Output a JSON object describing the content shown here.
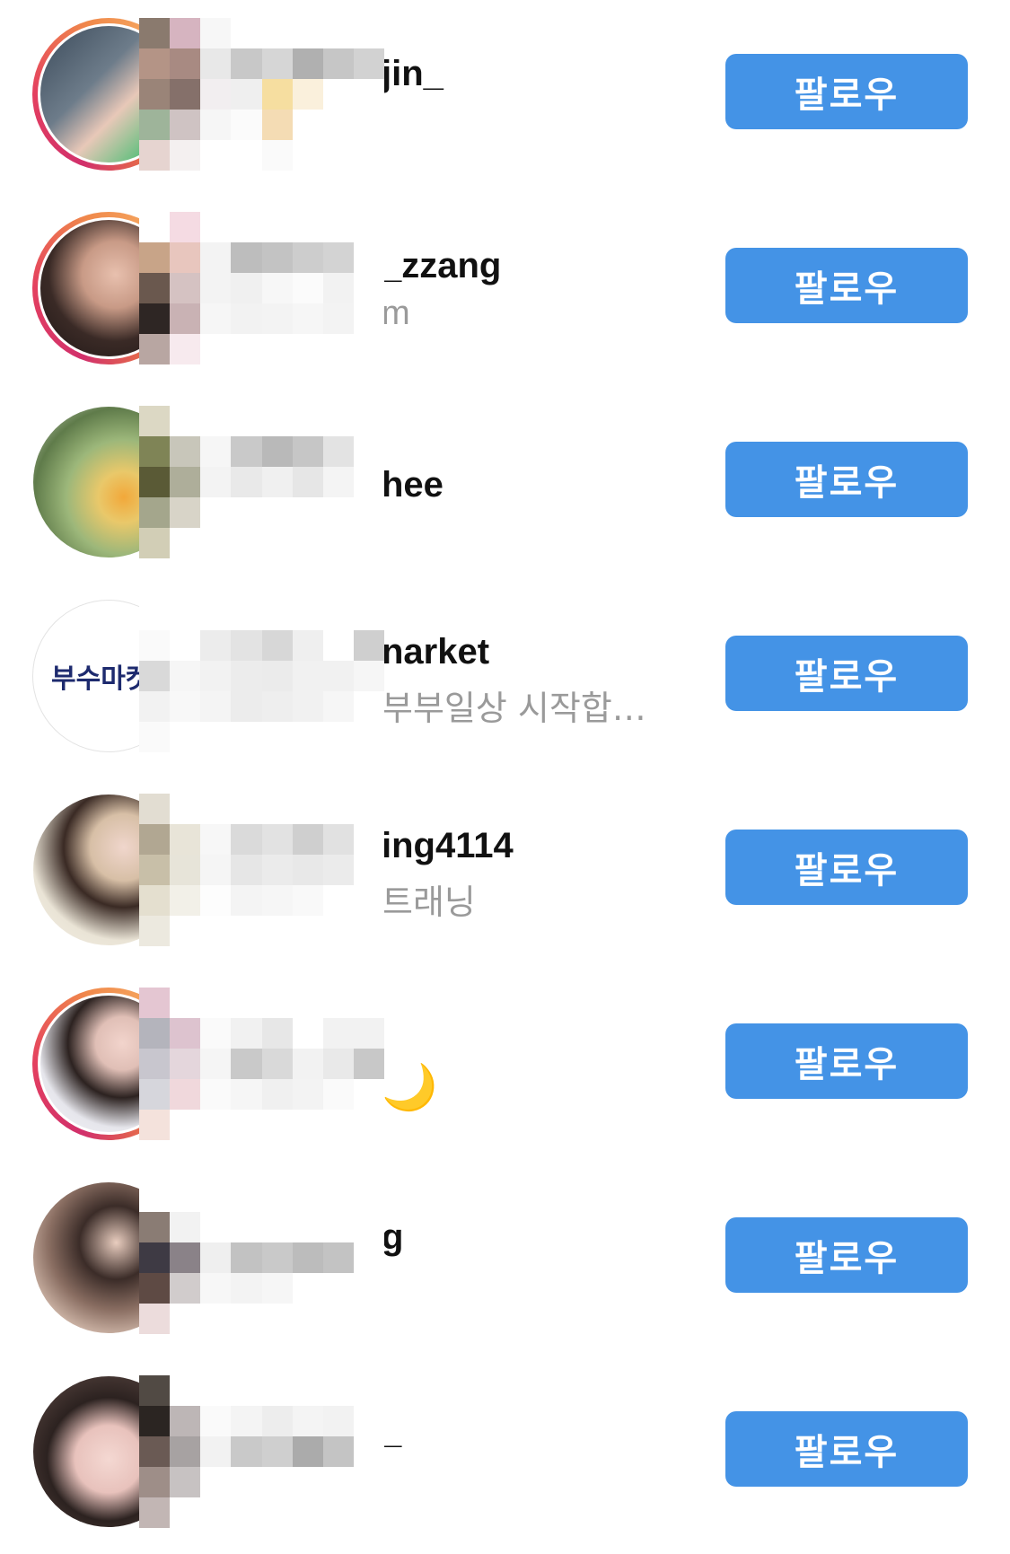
{
  "follow_label": "팔로우",
  "rows": [
    {
      "username": "jin_",
      "subtitle": "",
      "emoji": ""
    },
    {
      "username": "_zzang",
      "subtitle": "m",
      "emoji": ""
    },
    {
      "username": "hee",
      "subtitle": "",
      "emoji": ""
    },
    {
      "username": "narket",
      "subtitle": "부부일상 시작합…",
      "emoji": "",
      "avatar_text": "부수마켓"
    },
    {
      "username": "ing4114",
      "subtitle": "트래닝",
      "emoji": ""
    },
    {
      "username": "",
      "subtitle": "",
      "emoji": "🌙"
    },
    {
      "username": "g",
      "subtitle": "",
      "emoji": ""
    },
    {
      "username": "_",
      "subtitle": "",
      "emoji": ""
    }
  ],
  "colors": {
    "button": "#4493e6",
    "story_ring": [
      "#d1306b",
      "#f0894b",
      "#f7b267"
    ]
  }
}
